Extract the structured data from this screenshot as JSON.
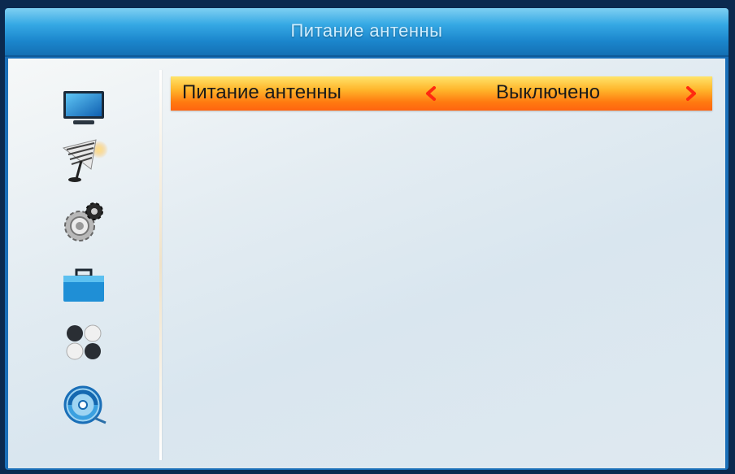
{
  "window": {
    "title": "Питание антенны"
  },
  "sidebar": {
    "items": [
      {
        "icon": "tv-icon"
      },
      {
        "icon": "satellite-dish-icon",
        "selected": true
      },
      {
        "icon": "gear-settings-icon"
      },
      {
        "icon": "toolbox-icon"
      },
      {
        "icon": "game-balls-icon"
      },
      {
        "icon": "media-disc-icon"
      }
    ]
  },
  "menu": {
    "rows": [
      {
        "label": "Питание антенны",
        "value": "Выключено"
      }
    ]
  },
  "colors": {
    "title_bar": "#1b86cc",
    "title_text": "#cfeeff",
    "highlight_top": "#ffe46a",
    "highlight_bottom": "#ff6410",
    "arrow": "#ff2a10",
    "content_bg": "#e3ecf2"
  }
}
